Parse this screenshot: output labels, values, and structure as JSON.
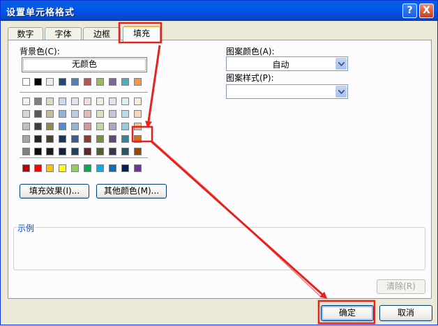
{
  "window": {
    "title": "设置单元格格式",
    "help_icon": "?",
    "close_icon": "X"
  },
  "tabs": [
    {
      "label": "数字"
    },
    {
      "label": "字体"
    },
    {
      "label": "边框"
    },
    {
      "label": "填充",
      "active": true
    }
  ],
  "fill": {
    "background_color_label": "背景色(C):",
    "no_color_label": "无颜色",
    "palette_top": [
      "#ffffff",
      "#000000",
      "#eeece1",
      "#1f497d",
      "#4f81bd",
      "#c0504d",
      "#9bbb59",
      "#8064a2",
      "#4bacc6",
      "#f79646"
    ],
    "palette_tints": [
      [
        "#f2f2f2",
        "#7f7f7f",
        "#ddd9c3",
        "#c6d9f0",
        "#dbe5f1",
        "#f2dcdb",
        "#ebf1dd",
        "#e5e0ec",
        "#dbeef3",
        "#fdeada"
      ],
      [
        "#d8d8d8",
        "#595959",
        "#c4bd97",
        "#8db3e2",
        "#b8cce4",
        "#e5b9b7",
        "#d7e3bc",
        "#ccc1d9",
        "#b7dde8",
        "#fbd5b5"
      ],
      [
        "#bfbfbf",
        "#3f3f3f",
        "#938953",
        "#548dd4",
        "#95b3d7",
        "#d99694",
        "#c3d69b",
        "#b2a2c7",
        "#92cddc",
        "#fac08f"
      ],
      [
        "#a5a5a5",
        "#262626",
        "#494429",
        "#17365d",
        "#366092",
        "#953734",
        "#76923c",
        "#5f497a",
        "#31859b",
        "#e36c09"
      ],
      [
        "#7f7f7f",
        "#0c0c0c",
        "#1d1b10",
        "#0f243e",
        "#244061",
        "#632423",
        "#4f6128",
        "#3f3151",
        "#205867",
        "#974806"
      ]
    ],
    "palette_standard": [
      "#c00000",
      "#ff0000",
      "#ffc000",
      "#ffff00",
      "#92d050",
      "#00b050",
      "#00b0f0",
      "#0070c0",
      "#002060",
      "#7030a0"
    ],
    "fill_effects_label": "填充效果(I)...",
    "more_colors_label": "其他颜色(M)...",
    "pattern_color_label": "图案颜色(A):",
    "pattern_color_value": "自动",
    "pattern_style_label": "图案样式(P):",
    "pattern_style_value": "",
    "preview_label": "示例",
    "clear_label": "清除(R)"
  },
  "footer": {
    "ok_label": "确定",
    "cancel_label": "取消"
  },
  "annotations": {
    "highlight_color": "#e8211b"
  }
}
